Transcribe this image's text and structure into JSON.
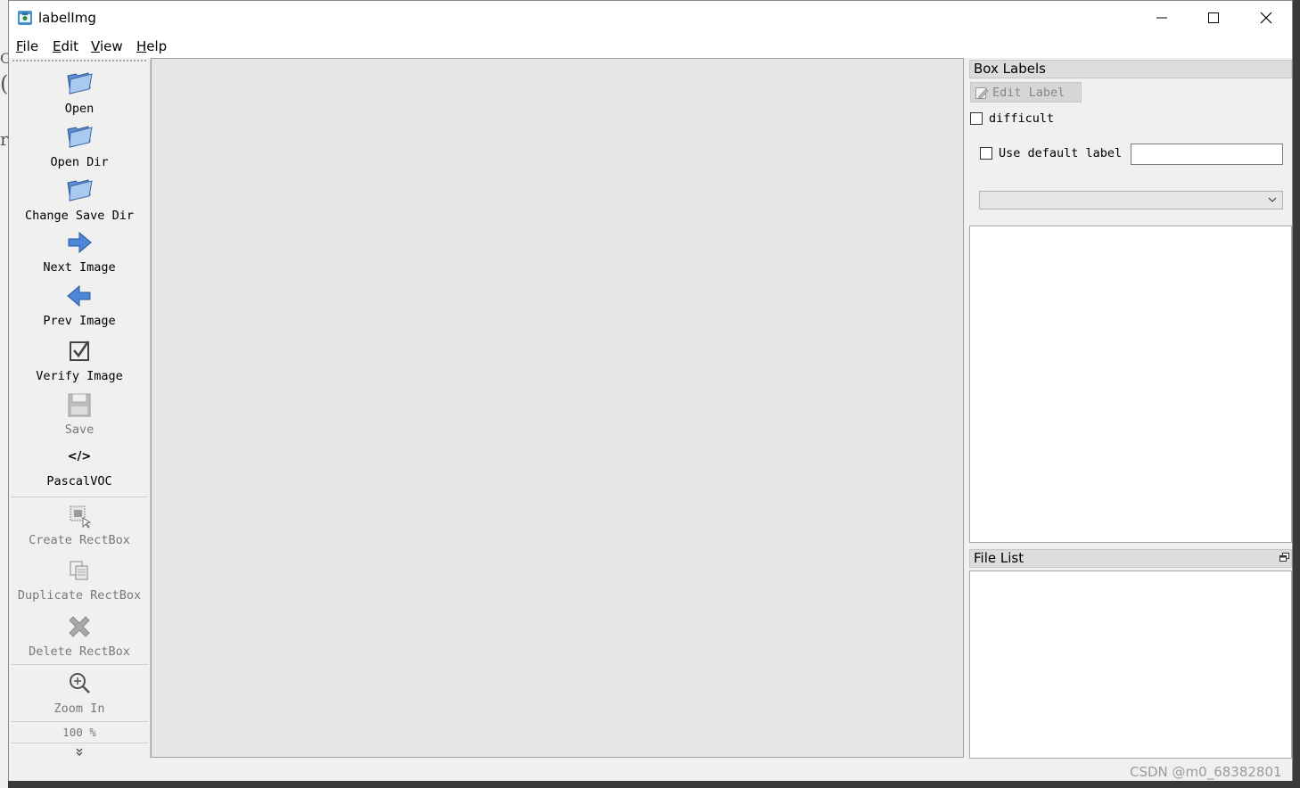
{
  "window": {
    "title": "labelImg"
  },
  "menu": [
    {
      "key": "F",
      "rest": "ile"
    },
    {
      "key": "E",
      "rest": "dit"
    },
    {
      "key": "V",
      "rest": "iew"
    },
    {
      "key": "H",
      "rest": "elp"
    }
  ],
  "toolbar": {
    "open": "Open",
    "open_dir": "Open Dir",
    "change_save_dir": "Change Save Dir",
    "next_image": "Next Image",
    "prev_image": "Prev Image",
    "verify_image": "Verify Image",
    "save": "Save",
    "format_glyph": "</>",
    "format": "PascalVOC",
    "create_rectbox": "Create RectBox",
    "duplicate_rectbox": "Duplicate RectBox",
    "delete_rectbox": "Delete RectBox",
    "zoom_in": "Zoom In",
    "zoom_level": "100 %"
  },
  "box_labels": {
    "title": "Box Labels",
    "edit_label": "Edit Label",
    "difficult": "difficult",
    "use_default_label": "Use default label",
    "default_label_value": ""
  },
  "file_list": {
    "title": "File List"
  },
  "watermark": "CSDN @m0_68382801",
  "colors": {
    "accent_blue": "#3a78c8",
    "folder_blue": "#8fb6e6",
    "panel_bg": "#f0f0f0"
  }
}
